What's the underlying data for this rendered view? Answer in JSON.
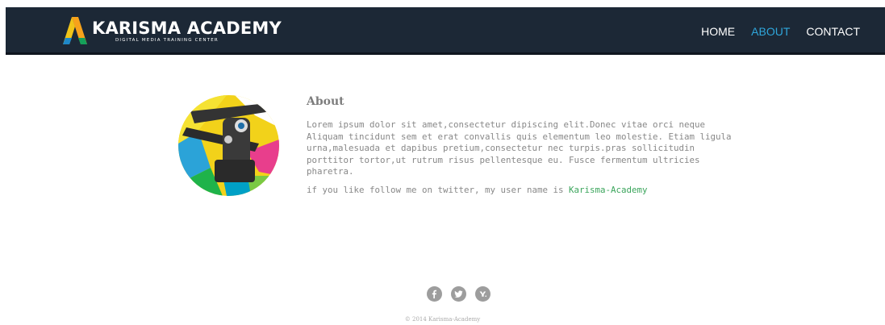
{
  "brand": {
    "name": "KARISMA ACADEMY",
    "tagline": "DIGITAL MEDIA TRAINING CENTER",
    "colors": {
      "navbar": "#1c2836",
      "accent": "#2fa6db",
      "link": "#3ba55c"
    }
  },
  "nav": {
    "items": [
      {
        "label": "HOME",
        "active": false
      },
      {
        "label": "ABOUT",
        "active": true
      },
      {
        "label": "CONTACT",
        "active": false
      }
    ]
  },
  "about": {
    "title": "About",
    "body": "Lorem ipsum dolor sit amet,consectetur dipiscing elit.Donec vitae orci neque\nAliquam tincidunt sem et erat convallis quis elementum leo molestie. Etiam ligula\nurna,malesuada et dapibus pretium,consectetur nec turpis.pras sollicitudin\nporttitor tortor,ut rutrum risus pellentesque eu. Fusce fermentum ultricies\npharetra.",
    "follow_prefix": "if you like follow me on twitter, my user name is ",
    "twitter_handle": "Karisma-Academy"
  },
  "footer": {
    "socials": [
      {
        "icon": "facebook-icon"
      },
      {
        "icon": "twitter-icon"
      },
      {
        "icon": "yahoo-icon"
      }
    ],
    "copyright": "© 2014 Karisma-Academy"
  }
}
